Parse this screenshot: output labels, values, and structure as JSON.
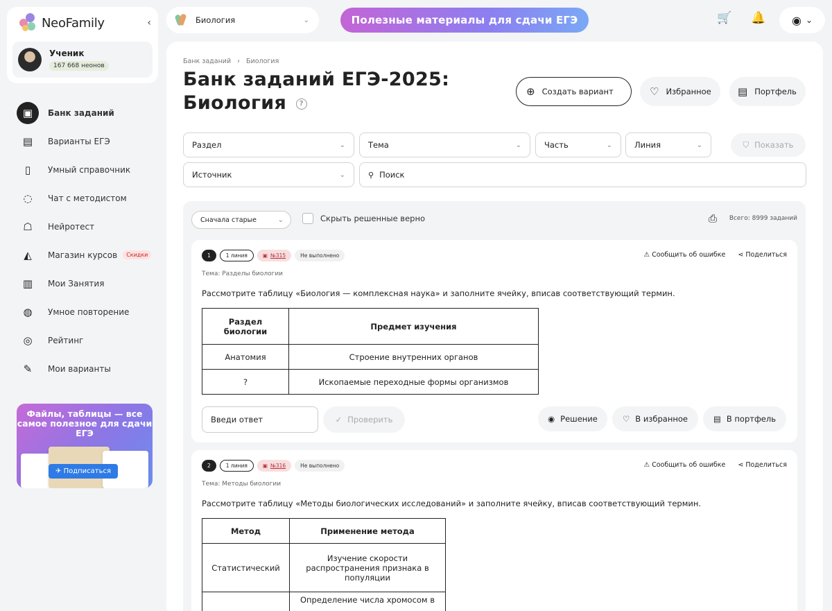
{
  "sidebar": {
    "brand": "NeoFamily",
    "collapse_icon": "‹",
    "user": {
      "name": "Ученик",
      "points": "167 668 неонов"
    },
    "nav": [
      {
        "label": "Банк заданий",
        "icon": "▣",
        "active": true
      },
      {
        "label": "Варианты ЕГЭ",
        "icon": "▤"
      },
      {
        "label": "Умный справочник",
        "icon": "▯"
      },
      {
        "label": "Чат с методистом",
        "icon": "◌"
      },
      {
        "label": "Нейротест",
        "icon": "☖"
      },
      {
        "label": "Магазин курсов",
        "icon": "◭",
        "badge": "Скидки"
      },
      {
        "label": "Мои Занятия",
        "icon": "▥"
      },
      {
        "label": "Умное повторение",
        "icon": "◍"
      },
      {
        "label": "Рейтинг",
        "icon": "◎"
      },
      {
        "label": "Мои варианты",
        "icon": "✎"
      }
    ],
    "promo": {
      "title": "Файлы, таблицы — все самое полезное для сдачи ЕГЭ",
      "button": "Подписаться"
    }
  },
  "topbar": {
    "subject": "Биология",
    "banner": "Полезные материалы для сдачи ЕГЭ",
    "cart_icon": "🛒",
    "bell_icon": "🔔",
    "profile_icon": "◉",
    "profile_chevron": "⌄"
  },
  "main": {
    "breadcrumb": [
      "Банк заданий",
      "Биология"
    ],
    "title_line1": "Банк заданий ЕГЭ-2025:",
    "title_line2": "Биология",
    "buttons": {
      "create": "Создать вариант",
      "favorites": "Избранное",
      "portfolio": "Портфель"
    },
    "filters": {
      "section": "Раздел",
      "topic": "Тема",
      "part": "Часть",
      "line": "Линия",
      "source": "Источник",
      "search_placeholder": "Поиск",
      "show": "Показать"
    },
    "list": {
      "sort": "Сначала старые",
      "hide_solved": "Скрыть решенные верно",
      "total": "Всего: 8999 заданий"
    }
  },
  "tasks": [
    {
      "num": "1",
      "line": "1 линия",
      "id": "№315",
      "status": "Не выполнено",
      "report": "Сообщить об ошибке",
      "share": "Поделиться",
      "topic": "Тема: Разделы биологии",
      "text": "Рассмотрите таблицу «Биология — комплексная наука» и заполните ячейку, вписав соответствующий термин.",
      "table": {
        "headers": [
          "Раздел биологии",
          "Предмет изучения"
        ],
        "rows": [
          [
            "Анатомия",
            "Строение внутренних органов"
          ],
          [
            "?",
            "Ископаемые переходные формы организмов"
          ]
        ]
      },
      "answer_placeholder": "Введи ответ",
      "check": "Проверить",
      "solution": "Решение",
      "fav": "В избранное",
      "portfolio": "В портфель"
    },
    {
      "num": "2",
      "line": "1 линия",
      "id": "№316",
      "status": "Не выполнено",
      "report": "Сообщить об ошибке",
      "share": "Поделиться",
      "topic": "Тема: Методы биологии",
      "text": "Рассмотрите таблицу «Методы биологических исследований» и заполните ячейку, вписав соответствующий термин.",
      "table": {
        "headers": [
          "Метод",
          "Применение метода"
        ],
        "rows": [
          [
            "Статистический",
            "Изучение скорости распространения признака в популяции"
          ],
          [
            "?",
            "Определение числа хромосом в"
          ]
        ]
      }
    }
  ]
}
